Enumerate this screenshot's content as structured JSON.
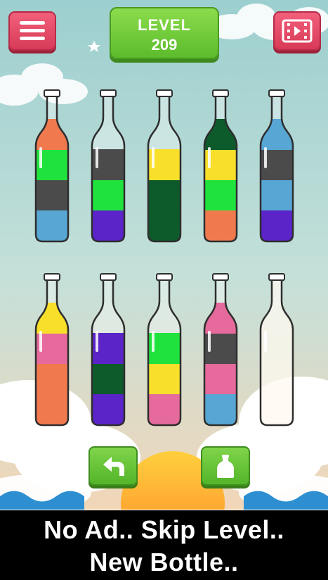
{
  "level": {
    "label": "LEVEL",
    "number": "209"
  },
  "colors": {
    "orange": "#f07a4e",
    "green": "#1fe33c",
    "gray": "#4b4b4b",
    "blue": "#57a6d3",
    "purple": "#5a24c8",
    "yellow": "#f8df2a",
    "darkgreen": "#0d5a2a",
    "pink": "#e66a9c",
    "accent_red": "#e24b68",
    "accent_green": "#63c032"
  },
  "bottles": [
    {
      "layers": [
        "blue",
        "gray",
        "green",
        "orange"
      ]
    },
    {
      "layers": [
        "purple",
        "green",
        "gray"
      ]
    },
    {
      "layers": [
        "darkgreen",
        "darkgreen",
        "yellow"
      ]
    },
    {
      "layers": [
        "orange",
        "green",
        "yellow",
        "darkgreen"
      ]
    },
    {
      "layers": [
        "purple",
        "blue",
        "gray",
        "blue"
      ]
    },
    {
      "layers": [
        "orange",
        "orange",
        "pink",
        "yellow"
      ]
    },
    {
      "layers": [
        "purple",
        "darkgreen",
        "purple"
      ]
    },
    {
      "layers": [
        "pink",
        "yellow",
        "green"
      ]
    },
    {
      "layers": [
        "blue",
        "pink",
        "gray",
        "pink"
      ]
    },
    {
      "layers": []
    }
  ],
  "buttons": {
    "menu": "menu-icon",
    "video": "video-icon",
    "undo": "undo-arrow-icon",
    "add_bottle": "bottle-icon"
  },
  "banner": {
    "line1": "No Ad.. Skip Level..",
    "line2": "New Bottle.."
  }
}
